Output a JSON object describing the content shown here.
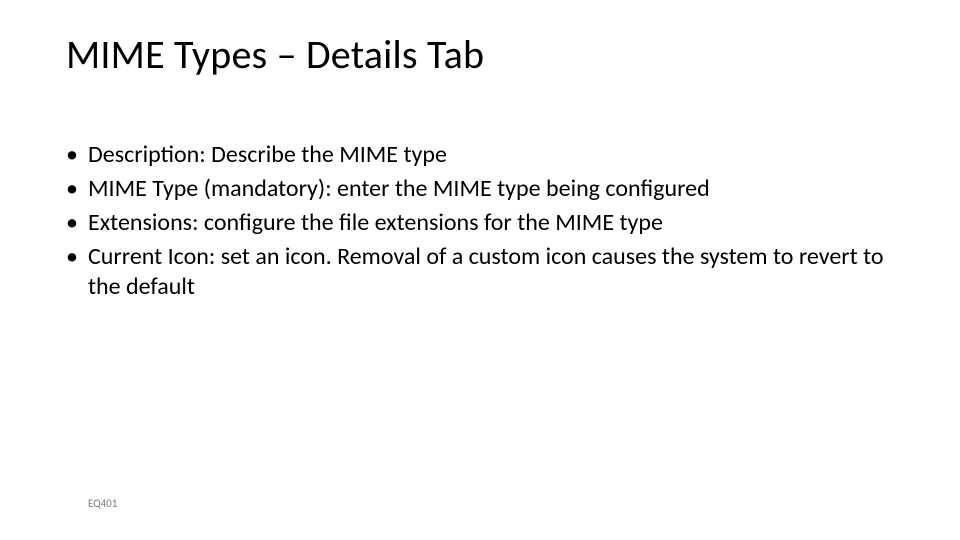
{
  "title": "MIME Types – Details Tab",
  "bullets": [
    "Description:  Describe the MIME type",
    "MIME Type (mandatory): enter the MIME type being configured",
    "Extensions:  configure the file extensions for the MIME type",
    "Current Icon: set an icon.  Removal of a custom icon causes the system to revert to the default"
  ],
  "footer": "EQ401"
}
